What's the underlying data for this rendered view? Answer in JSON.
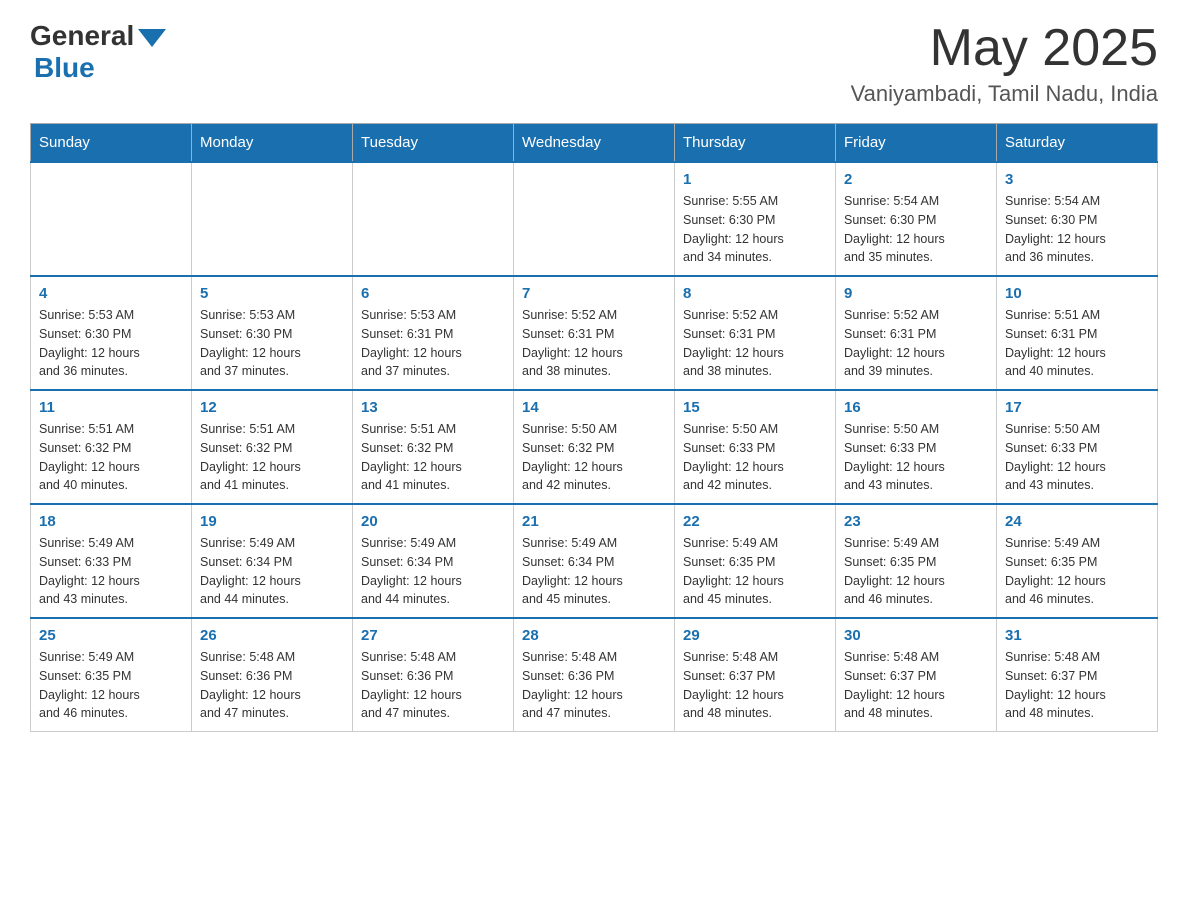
{
  "header": {
    "logo_general": "General",
    "logo_blue": "Blue",
    "month_title": "May 2025",
    "location": "Vaniyambadi, Tamil Nadu, India"
  },
  "calendar": {
    "days_of_week": [
      "Sunday",
      "Monday",
      "Tuesday",
      "Wednesday",
      "Thursday",
      "Friday",
      "Saturday"
    ],
    "weeks": [
      [
        {
          "day": "",
          "info": ""
        },
        {
          "day": "",
          "info": ""
        },
        {
          "day": "",
          "info": ""
        },
        {
          "day": "",
          "info": ""
        },
        {
          "day": "1",
          "info": "Sunrise: 5:55 AM\nSunset: 6:30 PM\nDaylight: 12 hours\nand 34 minutes."
        },
        {
          "day": "2",
          "info": "Sunrise: 5:54 AM\nSunset: 6:30 PM\nDaylight: 12 hours\nand 35 minutes."
        },
        {
          "day": "3",
          "info": "Sunrise: 5:54 AM\nSunset: 6:30 PM\nDaylight: 12 hours\nand 36 minutes."
        }
      ],
      [
        {
          "day": "4",
          "info": "Sunrise: 5:53 AM\nSunset: 6:30 PM\nDaylight: 12 hours\nand 36 minutes."
        },
        {
          "day": "5",
          "info": "Sunrise: 5:53 AM\nSunset: 6:30 PM\nDaylight: 12 hours\nand 37 minutes."
        },
        {
          "day": "6",
          "info": "Sunrise: 5:53 AM\nSunset: 6:31 PM\nDaylight: 12 hours\nand 37 minutes."
        },
        {
          "day": "7",
          "info": "Sunrise: 5:52 AM\nSunset: 6:31 PM\nDaylight: 12 hours\nand 38 minutes."
        },
        {
          "day": "8",
          "info": "Sunrise: 5:52 AM\nSunset: 6:31 PM\nDaylight: 12 hours\nand 38 minutes."
        },
        {
          "day": "9",
          "info": "Sunrise: 5:52 AM\nSunset: 6:31 PM\nDaylight: 12 hours\nand 39 minutes."
        },
        {
          "day": "10",
          "info": "Sunrise: 5:51 AM\nSunset: 6:31 PM\nDaylight: 12 hours\nand 40 minutes."
        }
      ],
      [
        {
          "day": "11",
          "info": "Sunrise: 5:51 AM\nSunset: 6:32 PM\nDaylight: 12 hours\nand 40 minutes."
        },
        {
          "day": "12",
          "info": "Sunrise: 5:51 AM\nSunset: 6:32 PM\nDaylight: 12 hours\nand 41 minutes."
        },
        {
          "day": "13",
          "info": "Sunrise: 5:51 AM\nSunset: 6:32 PM\nDaylight: 12 hours\nand 41 minutes."
        },
        {
          "day": "14",
          "info": "Sunrise: 5:50 AM\nSunset: 6:32 PM\nDaylight: 12 hours\nand 42 minutes."
        },
        {
          "day": "15",
          "info": "Sunrise: 5:50 AM\nSunset: 6:33 PM\nDaylight: 12 hours\nand 42 minutes."
        },
        {
          "day": "16",
          "info": "Sunrise: 5:50 AM\nSunset: 6:33 PM\nDaylight: 12 hours\nand 43 minutes."
        },
        {
          "day": "17",
          "info": "Sunrise: 5:50 AM\nSunset: 6:33 PM\nDaylight: 12 hours\nand 43 minutes."
        }
      ],
      [
        {
          "day": "18",
          "info": "Sunrise: 5:49 AM\nSunset: 6:33 PM\nDaylight: 12 hours\nand 43 minutes."
        },
        {
          "day": "19",
          "info": "Sunrise: 5:49 AM\nSunset: 6:34 PM\nDaylight: 12 hours\nand 44 minutes."
        },
        {
          "day": "20",
          "info": "Sunrise: 5:49 AM\nSunset: 6:34 PM\nDaylight: 12 hours\nand 44 minutes."
        },
        {
          "day": "21",
          "info": "Sunrise: 5:49 AM\nSunset: 6:34 PM\nDaylight: 12 hours\nand 45 minutes."
        },
        {
          "day": "22",
          "info": "Sunrise: 5:49 AM\nSunset: 6:35 PM\nDaylight: 12 hours\nand 45 minutes."
        },
        {
          "day": "23",
          "info": "Sunrise: 5:49 AM\nSunset: 6:35 PM\nDaylight: 12 hours\nand 46 minutes."
        },
        {
          "day": "24",
          "info": "Sunrise: 5:49 AM\nSunset: 6:35 PM\nDaylight: 12 hours\nand 46 minutes."
        }
      ],
      [
        {
          "day": "25",
          "info": "Sunrise: 5:49 AM\nSunset: 6:35 PM\nDaylight: 12 hours\nand 46 minutes."
        },
        {
          "day": "26",
          "info": "Sunrise: 5:48 AM\nSunset: 6:36 PM\nDaylight: 12 hours\nand 47 minutes."
        },
        {
          "day": "27",
          "info": "Sunrise: 5:48 AM\nSunset: 6:36 PM\nDaylight: 12 hours\nand 47 minutes."
        },
        {
          "day": "28",
          "info": "Sunrise: 5:48 AM\nSunset: 6:36 PM\nDaylight: 12 hours\nand 47 minutes."
        },
        {
          "day": "29",
          "info": "Sunrise: 5:48 AM\nSunset: 6:37 PM\nDaylight: 12 hours\nand 48 minutes."
        },
        {
          "day": "30",
          "info": "Sunrise: 5:48 AM\nSunset: 6:37 PM\nDaylight: 12 hours\nand 48 minutes."
        },
        {
          "day": "31",
          "info": "Sunrise: 5:48 AM\nSunset: 6:37 PM\nDaylight: 12 hours\nand 48 minutes."
        }
      ]
    ]
  }
}
